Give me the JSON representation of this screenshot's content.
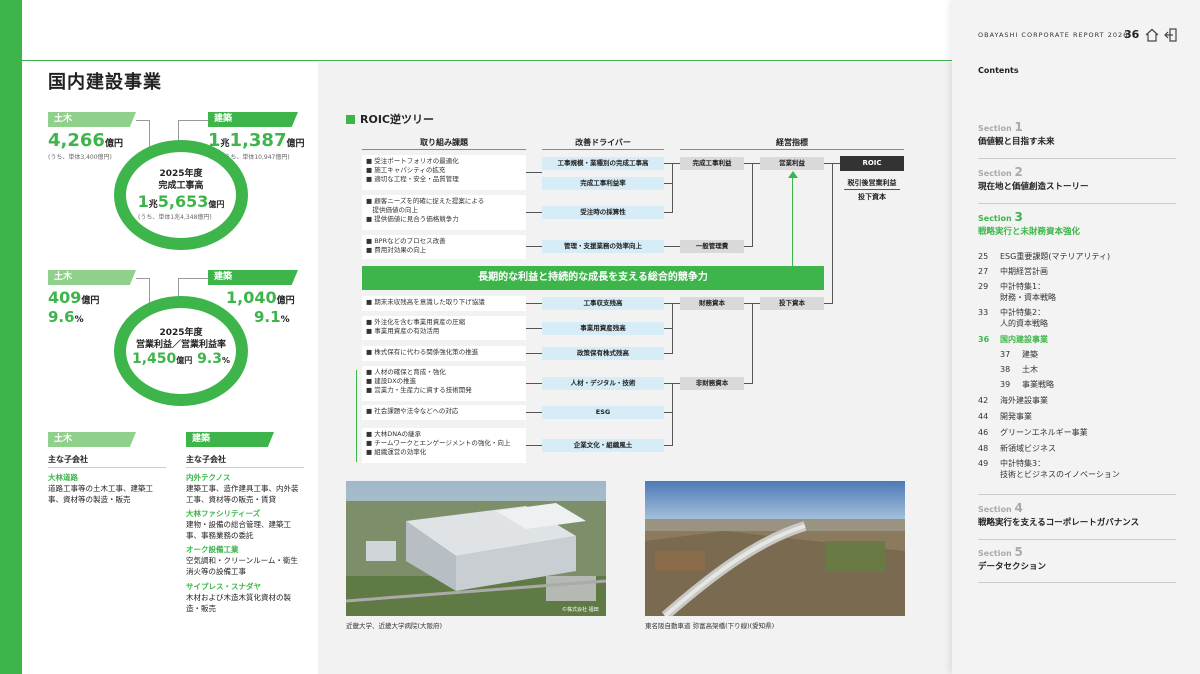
{
  "header": {
    "brand": "OBAYASHI CORPORATE REPORT 2026",
    "page_number": "36"
  },
  "left": {
    "title": "国内建設事業",
    "tab_civil": "土木",
    "tab_building": "建築",
    "orders": {
      "civil_value": "4,266",
      "civil_unit": "億円",
      "civil_note": "(うち、単体3,400億円)",
      "building_value_prefix": "1",
      "building_value_prefix_unit": "兆",
      "building_value": "1,387",
      "building_unit": "億円",
      "building_note": "(うち、単体10,947億円)",
      "ring_label1": "2025年度",
      "ring_label2": "完成工事高",
      "total_prefix": "1",
      "total_prefix_unit": "兆",
      "total_value": "5,653",
      "total_unit": "億円",
      "total_note": "(うち、単体1兆4,348億円)"
    },
    "profit": {
      "civil_value": "409",
      "civil_unit": "億円",
      "civil_rate": "9.6",
      "civil_rate_unit": "%",
      "building_value": "1,040",
      "building_unit": "億円",
      "building_rate": "9.1",
      "building_rate_unit": "%",
      "ring_label1": "2025年度",
      "ring_label2": "営業利益／営業利益率",
      "total_value": "1,450",
      "total_unit": "億円",
      "total_rate": "9.3",
      "total_rate_unit": "%"
    },
    "subsidiaries_heading": "主な子会社",
    "civil_subs": [
      {
        "name": "大林道路",
        "desc": "道路工事等の土木工事、建築工事、資材等の製造・販売"
      }
    ],
    "building_subs": [
      {
        "name": "内外テクノス",
        "desc": "建築工事、造作建具工事、内外装工事、資材等の販売・賃貸"
      },
      {
        "name": "大林ファシリティーズ",
        "desc": "建物・設備の総合管理、建築工事、事務業務の委託"
      },
      {
        "name": "オーク設備工業",
        "desc": "空気調和・クリーンルーム・衛生消火等の設備工事"
      },
      {
        "name": "サイプレス・スナダヤ",
        "desc": "木材および木造木質化資材の製造・販売"
      }
    ]
  },
  "tree": {
    "title": "ROIC逆ツリー",
    "col_actions": "取り組み課題",
    "col_drivers": "改善ドライバー",
    "col_kpi": "経営指標",
    "actions": [
      "■ 受注ポートフォリオの最適化\n■ 施工キャパシティの拡充\n■ 適切な工程・安全・品質管理",
      "■ 顧客ニーズを的確に捉えた提案による\n　提供価値の向上\n■ 提供価値に見合う価格競争力",
      "■ BPRなどのプロセス改善\n■ 費用対効果の向上",
      "■ 期末未収残高を意識した取り下げ協議",
      "■ 外注化を含む事業用資産の圧縮\n■ 事業用資産の有効活用",
      "■ 株式保有に代わる関係強化策の推進",
      "■ 人材の確保と育成・強化\n■ 建設DXの推進\n■ 営業力・生産力に資する技術開発",
      "■ 社会課題や法令などへの対応",
      "■ 大林DNAの継承\n■ チームワークとエンゲージメントの強化・向上\n■ 組織運営の効率化"
    ],
    "drivers": [
      "工事規模・業種別の完成工事高",
      "完成工事利益率",
      "受注時の採算性",
      "管理・支援業務の効率向上",
      "工事収支残高",
      "事業用資産残高",
      "政策保有株式残高",
      "人材・デジタル・技術",
      "ESG",
      "企業文化・組織風土"
    ],
    "kpi_mid": [
      "完成工事利益",
      "一般管理費",
      "財務資本",
      "非財務資本"
    ],
    "kpi_right": [
      "営業利益",
      "投下資本"
    ],
    "roic": "ROIC",
    "roic_sub1": "税引後営業利益",
    "roic_sub2": "投下資本",
    "banner": "長期的な利益と持続的な成長を支える総合的競争力"
  },
  "photos": {
    "left_caption": "近畿大学、近畿大学病院(大阪府)",
    "left_credit": "©株式会社 福田",
    "right_caption": "東名阪自動車道 弥富高架橋(下り線)(愛知県)"
  },
  "toc": {
    "label": "Contents",
    "sections": [
      {
        "kicker": "Section",
        "num": "1",
        "title": "価値観と目指す未来"
      },
      {
        "kicker": "Section",
        "num": "2",
        "title": "現在地と価値創造ストーリー"
      },
      {
        "kicker": "Section",
        "num": "3",
        "title": "戦略実行と未財務資本強化"
      },
      {
        "kicker": "Section",
        "num": "4",
        "title": "戦略実行を支えるコーポレートガバナンス"
      },
      {
        "kicker": "Section",
        "num": "5",
        "title": "データセクション"
      }
    ],
    "items": [
      {
        "n": "25",
        "t": "ESG重要課題(マテリアリティ)"
      },
      {
        "n": "27",
        "t": "中期経営計画"
      },
      {
        "n": "29",
        "t": "中計特集1："
      },
      {
        "n": "",
        "t": "財務・資本戦略"
      },
      {
        "n": "33",
        "t": "中計特集2："
      },
      {
        "n": "",
        "t": "人的資本戦略"
      },
      {
        "n": "36",
        "t": "国内建設事業"
      },
      {
        "n": "37",
        "t": "建築"
      },
      {
        "n": "38",
        "t": "土木"
      },
      {
        "n": "39",
        "t": "事業戦略"
      },
      {
        "n": "42",
        "t": "海外建設事業"
      },
      {
        "n": "44",
        "t": "開発事業"
      },
      {
        "n": "46",
        "t": "グリーンエネルギー事業"
      },
      {
        "n": "48",
        "t": "新領域ビジネス"
      },
      {
        "n": "49",
        "t": "中計特集3："
      },
      {
        "n": "",
        "t": "技術とビジネスのイノベーション"
      }
    ]
  },
  "colors": {
    "accent": "#3db54a",
    "accent_light": "#8fd08a",
    "driver_bg": "#d6ecf6",
    "kpi_bg": "#d9d9d9"
  }
}
